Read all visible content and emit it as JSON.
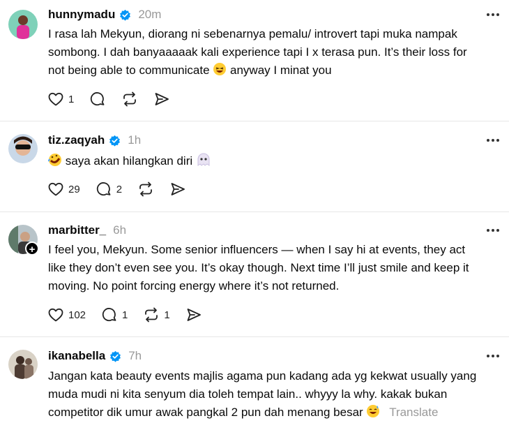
{
  "posts": [
    {
      "username": "hunnymadu",
      "time": "20m",
      "text_lines": [
        "I rasa lah Mekyun, diorang ni sebenarnya pemalu/ introvert tapi muka nampak",
        "sombong. I dah banyaaaaak kali experience tapi I x terasa pun. It’s their loss for",
        "not being able to communicate",
        "anyway I minat you"
      ],
      "likes": "1",
      "replies": "",
      "reposts": ""
    },
    {
      "username": "tiz.zaqyah",
      "time": "1h",
      "text_lines": [
        "saya akan hilangkan diri"
      ],
      "likes": "29",
      "replies": "2",
      "reposts": ""
    },
    {
      "username": "marbitter_",
      "time": "6h",
      "text_lines": [
        "I feel you, Mekyun. Some senior influencers — when I say hi at events, they act",
        "like they don’t even see you. It’s okay though. Next time I’ll just smile and keep it",
        "moving. No point forcing energy where it’s not returned."
      ],
      "likes": "102",
      "replies": "1",
      "reposts": "1"
    },
    {
      "username": "ikanabella",
      "time": "7h",
      "text_lines": [
        "Jangan kata beauty events majlis agama pun kadang ada yg kekwat usually yang",
        "muda mudi ni kita senyum dia toleh tempat lain.. whyyy la why. kakak bukan",
        "competitor dik umur awak pangkal 2 pun dah menang besar"
      ],
      "translate_label": "Translate"
    }
  ],
  "colors": {
    "verified": "#0095f6",
    "muted": "#999999",
    "divider": "#e6e6e6"
  },
  "icons": [
    "verified-icon",
    "more-icon",
    "heart-icon",
    "reply-icon",
    "repost-icon",
    "share-icon",
    "plus-icon"
  ]
}
